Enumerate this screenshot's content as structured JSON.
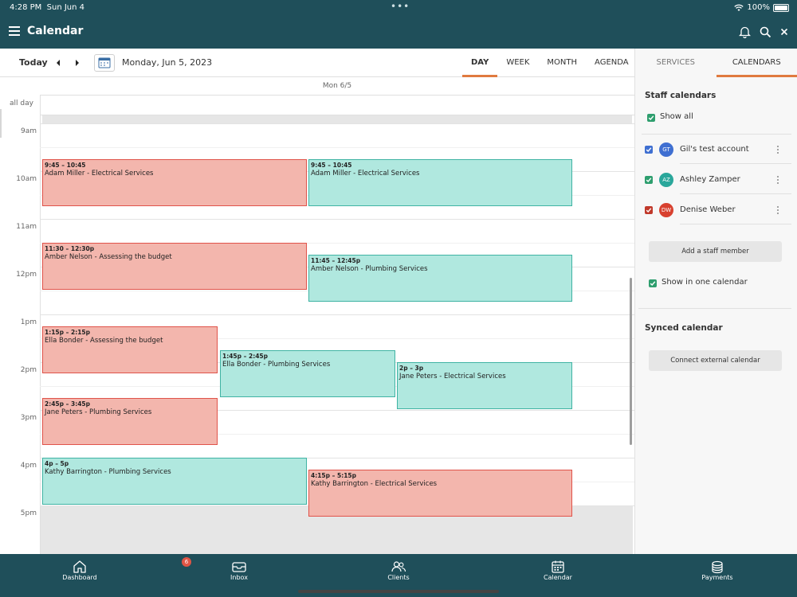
{
  "status_bar": {
    "time": "4:28 PM",
    "date": "Sun Jun 4",
    "battery": "100%"
  },
  "header": {
    "title": "Calendar"
  },
  "toolbar": {
    "today": "Today",
    "date": "Monday, Jun 5, 2023",
    "view_tabs": [
      "DAY",
      "WEEK",
      "MONTH",
      "AGENDA"
    ],
    "active_view": "DAY",
    "side_tabs": [
      "SERVICES",
      "CALENDARS"
    ],
    "active_side_tab": "CALENDARS"
  },
  "calendar": {
    "day_header": "Mon 6/5",
    "all_day": "all day",
    "hours": [
      "9am",
      "10am",
      "11am",
      "12pm",
      "1pm",
      "2pm",
      "3pm",
      "4pm",
      "5pm"
    ],
    "events": [
      {
        "time": "9:45 – 10:45",
        "title": "Adam Miller - Electrical Services",
        "color": "red"
      },
      {
        "time": "9:45 – 10:45",
        "title": "Adam Miller - Electrical Services",
        "color": "teal"
      },
      {
        "time": "11:30 – 12:30p",
        "title": "Amber Nelson - Assessing the budget",
        "color": "red"
      },
      {
        "time": "11:45 – 12:45p",
        "title": "Amber Nelson - Plumbing Services",
        "color": "teal"
      },
      {
        "time": "1:15p – 2:15p",
        "title": "Ella Bonder - Assessing the budget",
        "color": "red"
      },
      {
        "time": "1:45p – 2:45p",
        "title": "Ella Bonder - Plumbing Services",
        "color": "teal"
      },
      {
        "time": "2p – 3p",
        "title": "Jane Peters - Electrical Services",
        "color": "teal"
      },
      {
        "time": "2:45p – 3:45p",
        "title": "Jane Peters - Plumbing Services",
        "color": "red"
      },
      {
        "time": "4p – 5p",
        "title": "Kathy Barrington - Plumbing Services",
        "color": "teal"
      },
      {
        "time": "4:15p – 5:15p",
        "title": "Kathy Barrington - Electrical Services",
        "color": "red"
      }
    ]
  },
  "sidebar": {
    "staff_heading": "Staff calendars",
    "show_all": "Show all",
    "staff": [
      {
        "initials": "GT",
        "name": "Gil's test account",
        "color": "#3f6fd1"
      },
      {
        "initials": "AZ",
        "name": "Ashley Zamper",
        "color": "#2aa79b"
      },
      {
        "initials": "DW",
        "name": "Denise Weber",
        "color": "#d8412f"
      }
    ],
    "add_staff": "Add a staff member",
    "show_one": "Show in one calendar",
    "synced_heading": "Synced calendar",
    "connect": "Connect external calendar"
  },
  "bottom_nav": {
    "items": [
      "Dashboard",
      "Inbox",
      "Clients",
      "Calendar",
      "Payments"
    ],
    "inbox_badge": "6"
  },
  "colors": {
    "primary": "#1f4f5a",
    "accent": "#e07a3f",
    "event_red_fill": "#f3b6ad",
    "event_teal_fill": "#b0e8df",
    "check_green": "#2e9e6e"
  }
}
